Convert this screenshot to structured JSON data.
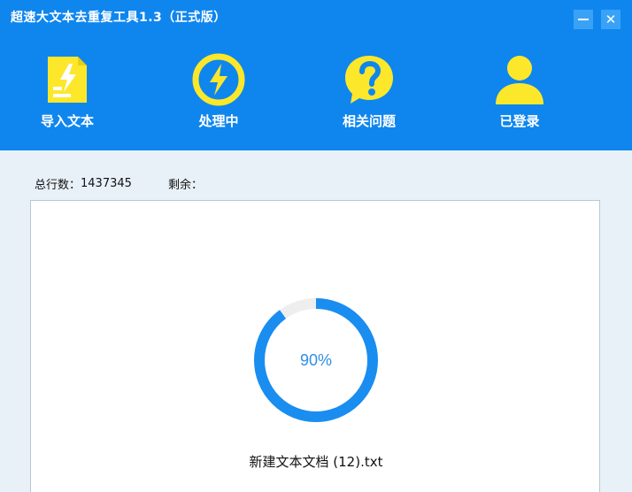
{
  "window": {
    "title": "超速大文本去重复工具1.3（正式版）",
    "minimize_icon": "minimize-icon",
    "close_glyph": "✕"
  },
  "toolbar": {
    "items": [
      {
        "label": "导入文本",
        "icon": "import-text-icon"
      },
      {
        "label": "处理中",
        "icon": "lightning-icon"
      },
      {
        "label": "相关问题",
        "icon": "question-icon"
      },
      {
        "label": "已登录",
        "icon": "user-icon"
      }
    ]
  },
  "stats": {
    "total_lines_label": "总行数：",
    "total_lines_value": "1437345",
    "remaining_label": "剩余："
  },
  "progress": {
    "percent_text": "90%",
    "fraction": 0.9,
    "filename": "新建文本文档 (12).txt"
  },
  "colors": {
    "header_bg": "#0f86ee",
    "icon_yellow": "#fde72b",
    "ring_blue": "#1a8df0",
    "ring_track": "#eeeeee"
  }
}
